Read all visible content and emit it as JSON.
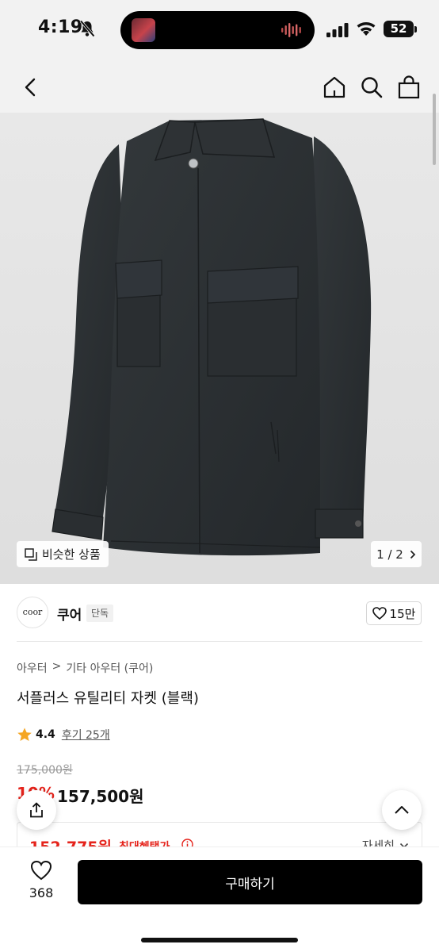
{
  "status_bar": {
    "time": "4:19",
    "battery": "52",
    "icons": [
      "bell-slash-icon",
      "signal-icon",
      "wifi-icon",
      "battery-icon"
    ]
  },
  "nav": {
    "icons": [
      "chevron-left-icon",
      "home-icon",
      "search-icon",
      "shopping-bag-icon"
    ]
  },
  "hero": {
    "similar_label": "비슷한 상품",
    "page_indicator": "1 / 2",
    "bg_color": "#e3e3e3",
    "jacket_color": "#2b2f32"
  },
  "brand": {
    "logo_text": "coor",
    "name": "쿠어",
    "tag": "단독",
    "likes": "15만"
  },
  "product": {
    "breadcrumb": [
      "아우터",
      ">",
      "기타 아우터 (쿠어)"
    ],
    "title": "서플러스 유틸리티 자켓 (블랙)",
    "rating": "4.4",
    "reviews": "후기 25개",
    "original_price": "175,000원",
    "discount": "10%",
    "sale_price": "157,500원"
  },
  "benefit": {
    "price": "152,775원",
    "label": "최대혜택가",
    "detail": "자세히"
  },
  "bottom_bar": {
    "wish_count": "368",
    "buy_label": "구매하기"
  },
  "colors": {
    "accent_red": "#e5231b",
    "primary_black": "#000000"
  }
}
